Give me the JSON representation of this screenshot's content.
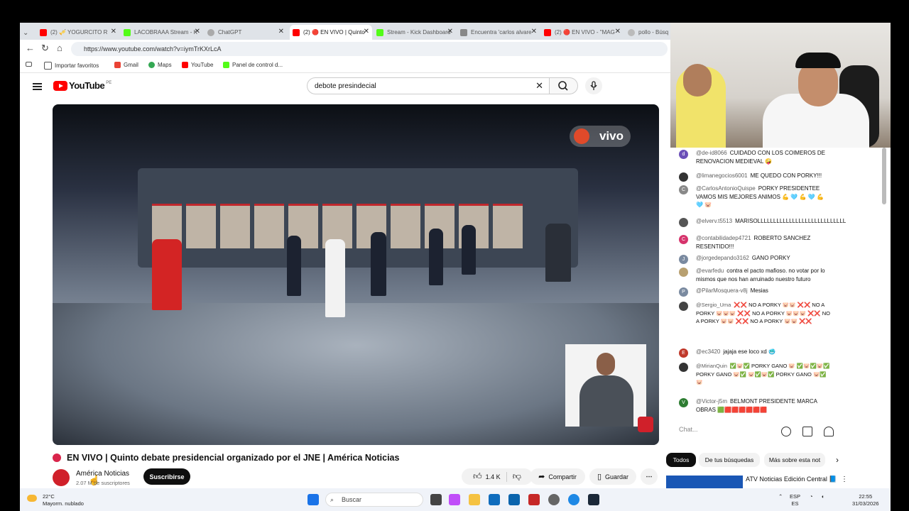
{
  "browser": {
    "tabs": [
      {
        "label": "(2) 🎺 YOGURCITO R",
        "color": "#ff0000"
      },
      {
        "label": "LACOBRAAA Stream - K",
        "color": "#53fc18"
      },
      {
        "label": "ChatGPT",
        "color": "#777777"
      },
      {
        "label": "(2) 🔴 EN VIVO | Quinto",
        "color": "#ff0000"
      },
      {
        "label": "Stream - Kick Dashboard",
        "color": "#53fc18"
      },
      {
        "label": "Encuentra 'carlos alvare",
        "color": "#777777"
      },
      {
        "label": "(2) 🔴 EN VIVO - \"MAG",
        "color": "#ff0000"
      },
      {
        "label": "pollo - Búsq",
        "color": "#999999"
      }
    ],
    "url": "https://www.youtube.com/watch?v=iymTrKXrLcA",
    "bookmarks": [
      "Importar favoritos",
      "Gmail",
      "Maps",
      "YouTube",
      "Panel de control d..."
    ]
  },
  "youtube": {
    "logo": "YouTube",
    "country": "PE",
    "search_query": "debote presindecial",
    "video": {
      "live_badge": "vivo",
      "title": "EN VIVO | Quinto debate presidencial organizado por el JNE | América Noticias",
      "channel": "América Noticias",
      "subscribers": "2.07 M de suscriptores",
      "subscribe_label": "Suscribirse",
      "likes": "1.4 K",
      "share_label": "Compartir",
      "save_label": "Guardar"
    }
  },
  "chat": {
    "messages": [
      {
        "user": "@de-id8066",
        "text": "CUIDADO CON LOS COIMEROS DE RENOVACION MEDIEVAL 🤪",
        "avatar": "d",
        "color": "#6b4fb8"
      },
      {
        "user": "@limanegocios6001",
        "text": "ME QUEDO CON PORKY!!!",
        "avatar": "",
        "color": "#333333"
      },
      {
        "user": "@CarlosAntonioQuispe",
        "text": "PORKY PRESIDENTEE VAMOS MIS MEJORES ANIMOS 💪 🩵 💪 🩵 💪 🩵 🐷",
        "avatar": "C",
        "color": "#888888"
      },
      {
        "user": "@elverv.t5513",
        "text": "MARISOLLLLLLLLLLLLLLLLLLLLLLLLLLLL",
        "avatar": "",
        "color": "#555555"
      },
      {
        "user": "@contabilidadep4721",
        "text": "ROBERTO SANCHEZ RESENTIDO!!!",
        "avatar": "C",
        "color": "#d6336c"
      },
      {
        "user": "@jorgedepando3162",
        "text": "GANO PORKY",
        "avatar": "J",
        "color": "#7a8aa0"
      },
      {
        "user": "@evarfedu",
        "text": "contra el pacto mafioso. no votar por lo mismos que nos han arruinado nuestro futuro",
        "avatar": "",
        "color": "#b8a070"
      },
      {
        "user": "@PilarMosquera-v8j",
        "text": "Mesias",
        "avatar": "P",
        "color": "#7a8aa0"
      },
      {
        "user": "@Sergio_Uma",
        "text": "❌❌ NO A PORKY 🐷🐷 ❌❌ NO A PORKY 🐷🐷🐷 ❌❌ NO A PORKY 🐷🐷🐷 ❌❌ NO A PORKY 🐷🐷 ❌❌ NO A PORKY 🐷🐷 ❌❌",
        "avatar": "",
        "color": "#444444"
      },
      {
        "user": "@ec3420",
        "text": "jajaja ese loco xd 🥶",
        "avatar": "E",
        "color": "#c0392b"
      },
      {
        "user": "@MirianQuin",
        "text": "✅🐷✅ PORKY GANO 🐷 ✅🐷✅🐷✅ PORKY GANO 🐷✅ 🐷✅🐷✅ PORKY GANO 🐷✅🐷",
        "avatar": "",
        "color": "#333333"
      },
      {
        "user": "@Victor-j5m",
        "text": "BELMONT PRESIDENTE MARCA OBRAS 🟩🟥🟥🟥🟥🟥🟥",
        "avatar": "V",
        "color": "#2e7d32"
      }
    ],
    "input_placeholder": "Chat...",
    "filters": [
      "Todos",
      "De tus búsquedas",
      "Más sobre esta not"
    ],
    "related_title": "ATV Noticias Edición Central 📘"
  },
  "taskbar": {
    "temp": "22°C",
    "weather": "Mayorm. nublado",
    "search_placeholder": "Buscar",
    "lang": "ESP",
    "lang2": "ES",
    "time": "22:55",
    "date": "31/03/2026"
  }
}
